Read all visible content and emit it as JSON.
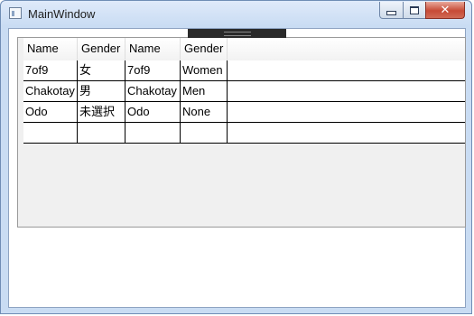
{
  "window": {
    "title": "MainWindow"
  },
  "grid": {
    "columns": [
      "Name",
      "Gender",
      "Name",
      "Gender"
    ],
    "rows": [
      [
        "7of9",
        "女",
        "7of9",
        "Women"
      ],
      [
        "Chakotay",
        "男",
        "Chakotay",
        "Men"
      ],
      [
        "Odo",
        "未選択",
        "Odo",
        "None"
      ],
      [
        "",
        "",
        "",
        ""
      ]
    ]
  },
  "colors": {
    "titlebar": "#c9dcf3",
    "close_button": "#c74a36",
    "grid_background": "#f0f0f0"
  }
}
